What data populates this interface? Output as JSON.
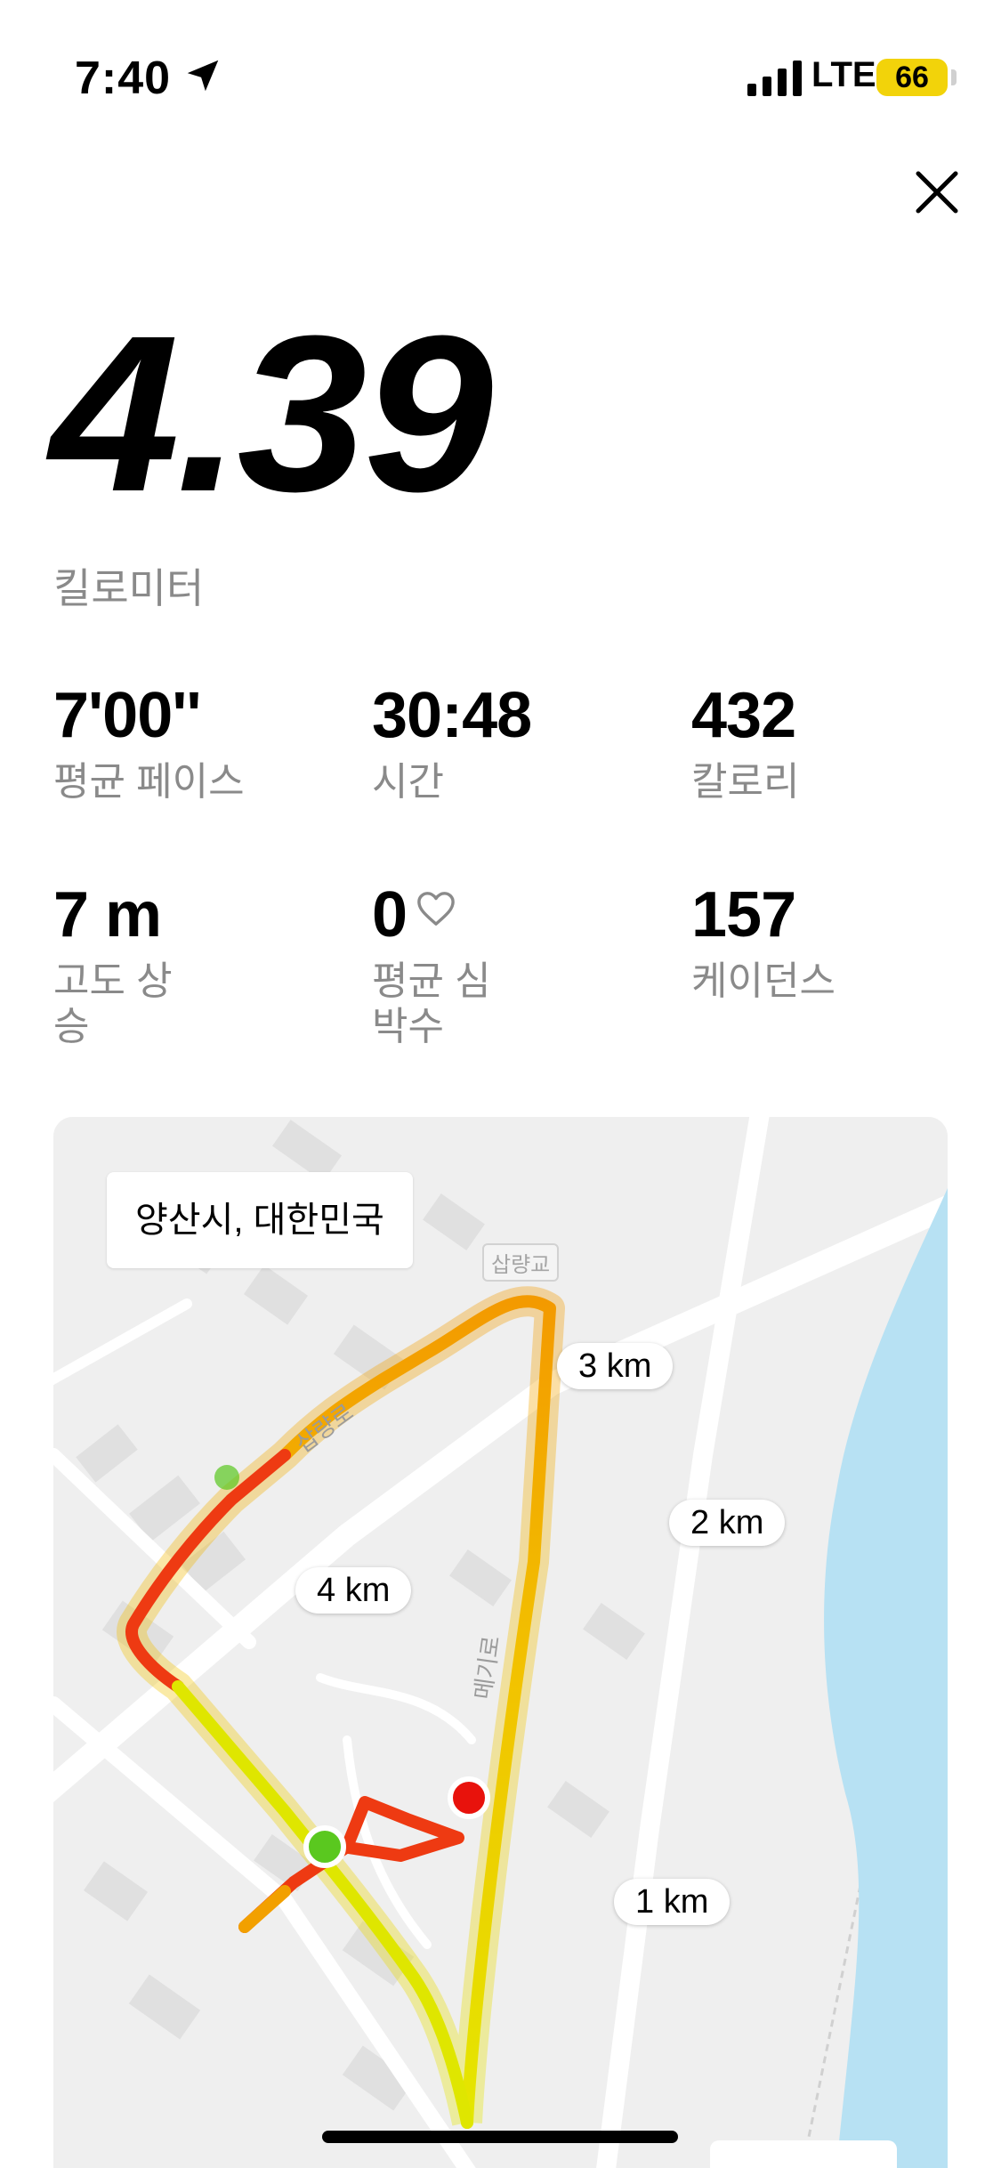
{
  "status_bar": {
    "time": "7:40",
    "network": "LTE",
    "battery": "66"
  },
  "run": {
    "distance": "4.39",
    "distance_unit": "킬로미터"
  },
  "stats": [
    {
      "value": "7'00''",
      "label": "평균 페이스"
    },
    {
      "value": "30:48",
      "label": "시간"
    },
    {
      "value": "432",
      "label": "칼로리"
    },
    {
      "value": "7 m",
      "label": "고도 상승"
    },
    {
      "value": "0",
      "label": "평균 심박수"
    },
    {
      "value": "157",
      "label": "케이던스"
    }
  ],
  "map": {
    "location": "양산시, 대한민국",
    "km_markers": [
      "1 km",
      "2 km",
      "3 km",
      "4 km"
    ],
    "road_labels": [
      "삽량로",
      "메기로"
    ],
    "bridge_label": "삽량교"
  },
  "colors": {
    "battery": "#f2d30a",
    "start_marker": "#5ac81f",
    "end_marker": "#e8120c",
    "river": "#b7e1f3"
  },
  "icons": [
    "location-arrow-icon",
    "signal-icon",
    "close-icon",
    "heart-icon"
  ]
}
